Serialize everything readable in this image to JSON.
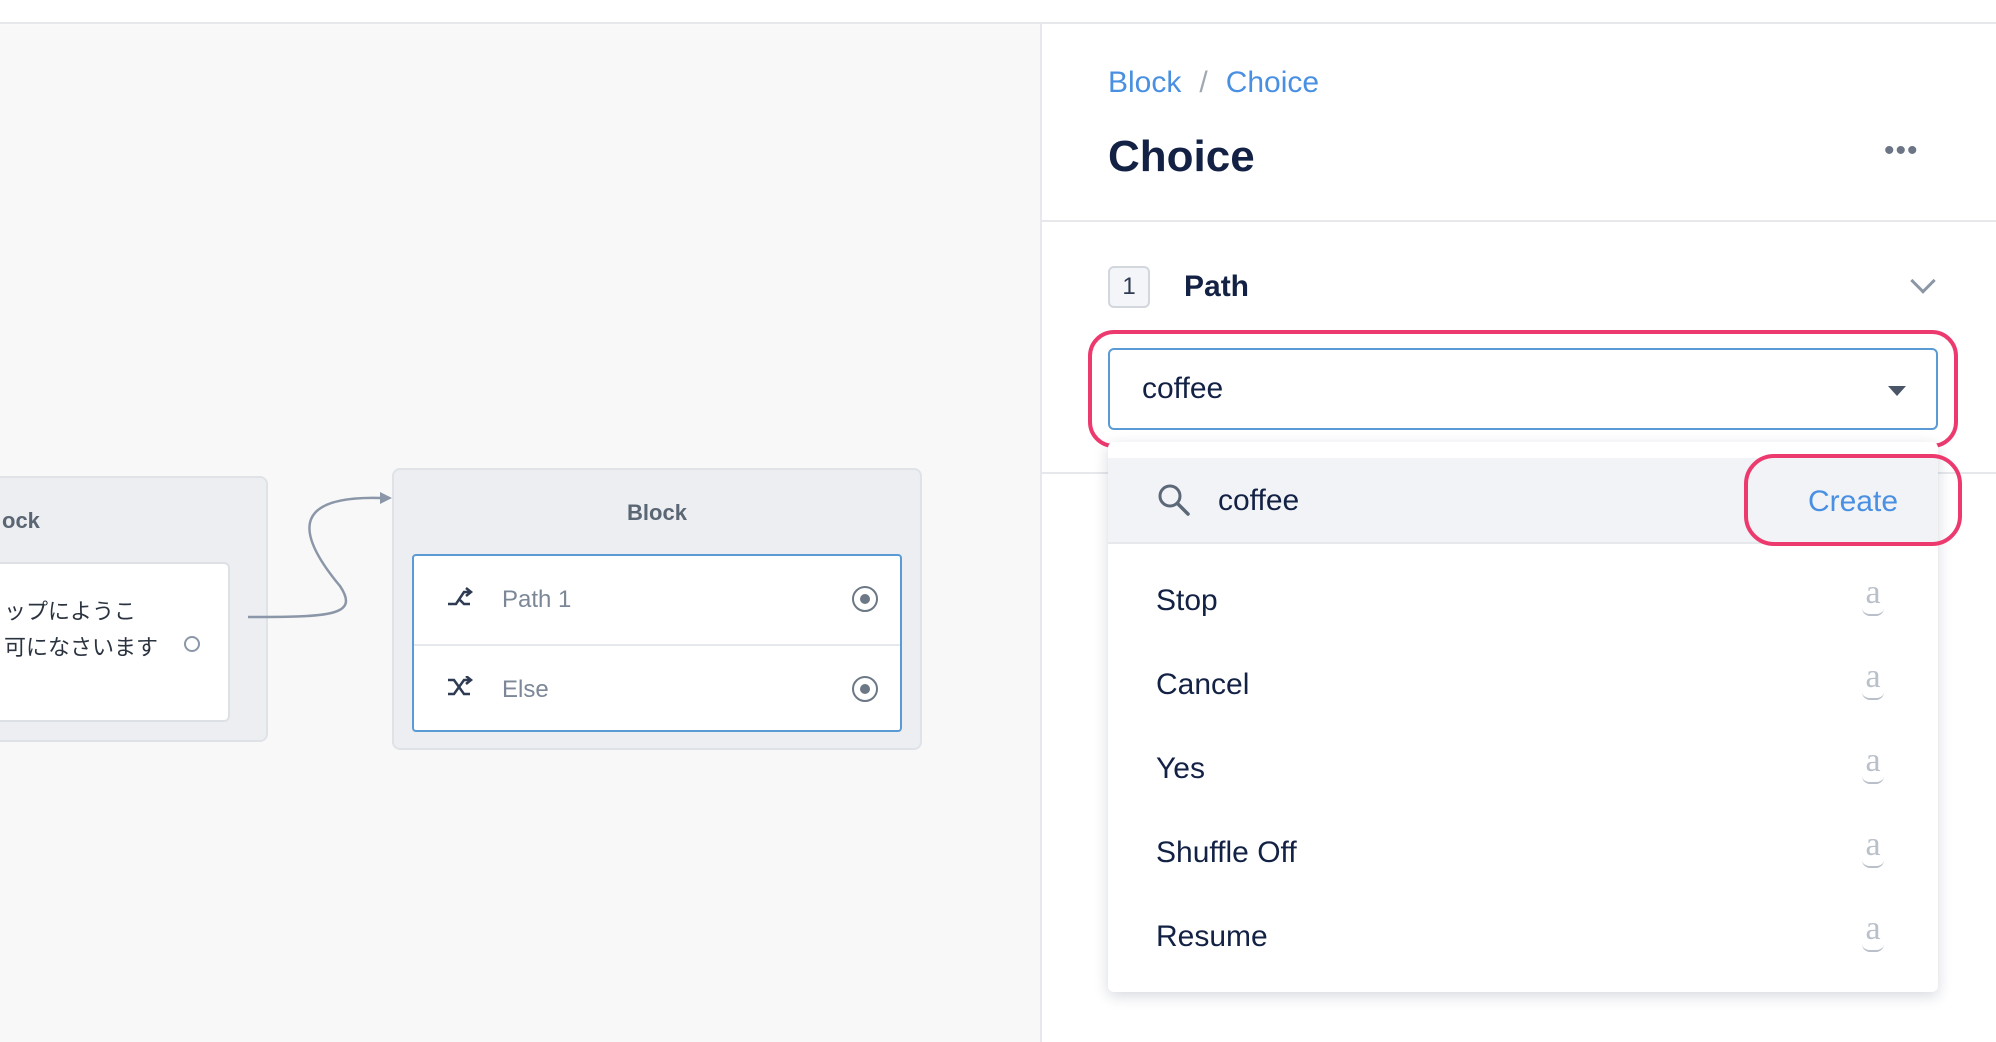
{
  "canvas": {
    "left_block": {
      "title": "ock",
      "text_line_1": "ップにようこ",
      "text_line_2": "可になさいます"
    },
    "main_block": {
      "title": "Block",
      "paths": [
        {
          "label": "Path 1",
          "icon": "shuffle-icon"
        },
        {
          "label": "Else",
          "icon": "shuffle-crossed-icon"
        }
      ]
    }
  },
  "panel": {
    "breadcrumb": {
      "parent": "Block",
      "separator": "/",
      "current": "Choice"
    },
    "title": "Choice",
    "more_label": "•••",
    "path_section": {
      "number": "1",
      "title": "Path",
      "selected_value": "coffee"
    },
    "dropdown": {
      "search_value": "coffee",
      "create_label": "Create",
      "options": [
        {
          "label": "Stop",
          "icon": "amazon-icon"
        },
        {
          "label": "Cancel",
          "icon": "amazon-icon"
        },
        {
          "label": "Yes",
          "icon": "amazon-icon"
        },
        {
          "label": "Shuffle Off",
          "icon": "amazon-icon"
        },
        {
          "label": "Resume",
          "icon": "amazon-icon"
        }
      ]
    }
  },
  "colors": {
    "accent": "#4a90e2",
    "highlight": "#ec3a6f",
    "title_text": "#132144"
  }
}
